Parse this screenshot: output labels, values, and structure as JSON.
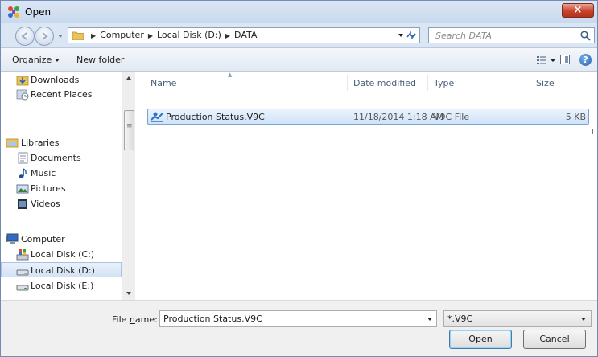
{
  "window": {
    "title": "Open",
    "close_label": "×"
  },
  "address": {
    "crumbs": [
      "Computer",
      "Local Disk (D:)",
      "DATA"
    ],
    "sep": "▶"
  },
  "search": {
    "placeholder": "Search DATA"
  },
  "toolbar": {
    "organize_label": "Organize",
    "new_folder_label": "New folder",
    "help_label": "?"
  },
  "nav_pane": {
    "items": [
      {
        "label": "Downloads",
        "icon": "downloads-icon"
      },
      {
        "label": "Recent Places",
        "icon": "recent-places-icon"
      },
      {
        "label": "Libraries",
        "icon": "libraries-icon"
      },
      {
        "label": "Documents",
        "icon": "documents-icon"
      },
      {
        "label": "Music",
        "icon": "music-icon"
      },
      {
        "label": "Pictures",
        "icon": "pictures-icon"
      },
      {
        "label": "Videos",
        "icon": "videos-icon"
      },
      {
        "label": "Computer",
        "icon": "computer-icon"
      },
      {
        "label": "Local Disk (C:)",
        "icon": "system-drive-icon"
      },
      {
        "label": "Local Disk (D:)",
        "icon": "drive-icon",
        "selected": true
      },
      {
        "label": "Local Disk (E:)",
        "icon": "drive-icon"
      }
    ]
  },
  "file_list": {
    "columns": [
      "Name",
      "Date modified",
      "Type",
      "Size"
    ],
    "rows": [
      {
        "name": "Production Status.V9C",
        "date_modified": "11/18/2014 1:18 AM",
        "type": "V9C File",
        "size": "5 KB"
      }
    ]
  },
  "footer": {
    "file_name_label_pre": "File ",
    "file_name_label_accel": "n",
    "file_name_label_post": "ame:",
    "file_name_value": "Production Status.V9C",
    "file_type_value": "*.V9C",
    "open_label": "Open",
    "cancel_label": "Cancel"
  },
  "colors": {
    "titlebar": "#c9d9ee",
    "selection": "#cfe3f8",
    "close": "#c7432b"
  }
}
